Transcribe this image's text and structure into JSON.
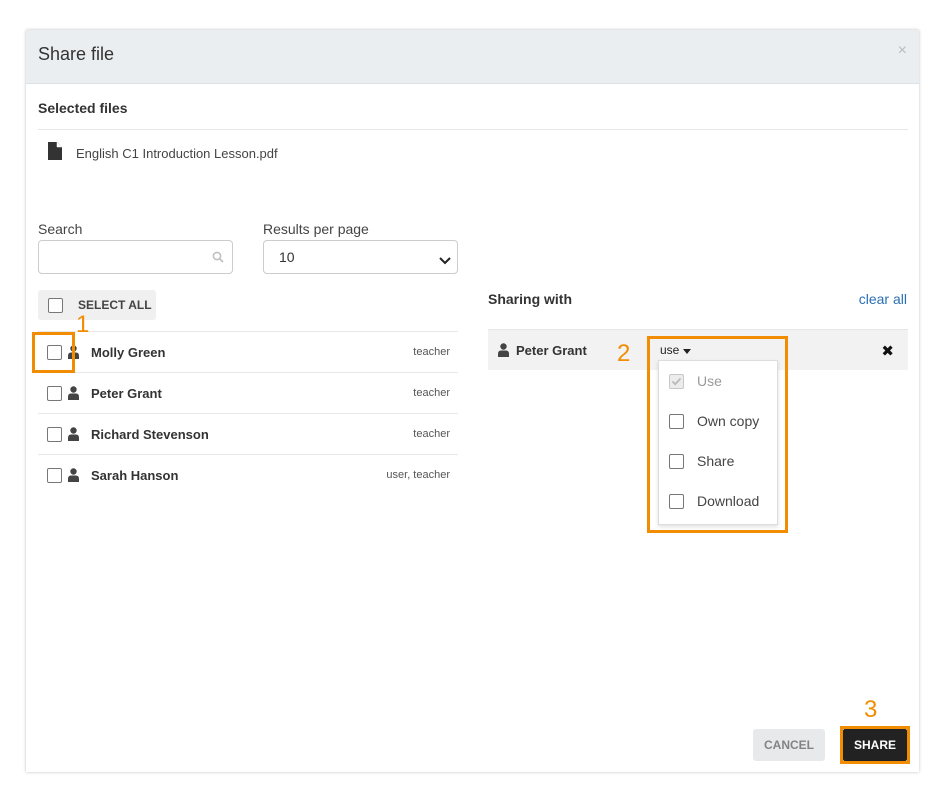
{
  "dialog": {
    "title": "Share file",
    "close_glyph": "×"
  },
  "selected_files": {
    "label": "Selected files",
    "files": [
      {
        "name": "English C1 Introduction Lesson.pdf",
        "icon": "file-icon"
      }
    ]
  },
  "search": {
    "label": "Search",
    "value": "",
    "placeholder": ""
  },
  "results_per_page": {
    "label": "Results per page",
    "selected": "10"
  },
  "select_all": {
    "label": "SELECT ALL",
    "checked": false
  },
  "users": [
    {
      "name": "Molly Green",
      "role": "teacher",
      "checked": false
    },
    {
      "name": "Peter Grant",
      "role": "teacher",
      "checked": false
    },
    {
      "name": "Richard Stevenson",
      "role": "teacher",
      "checked": false
    },
    {
      "name": "Sarah Hanson",
      "role": "user, teacher",
      "checked": false
    }
  ],
  "sharing": {
    "label": "Sharing with",
    "clear_all": "clear all",
    "entries": [
      {
        "name": "Peter Grant",
        "permission_label": "use",
        "remove_glyph": "✖"
      }
    ]
  },
  "permissions_menu": {
    "items": [
      {
        "label": "Use",
        "checked": true,
        "disabled": true
      },
      {
        "label": "Own copy",
        "checked": false,
        "disabled": false
      },
      {
        "label": "Share",
        "checked": false,
        "disabled": false
      },
      {
        "label": "Download",
        "checked": false,
        "disabled": false
      }
    ]
  },
  "footer": {
    "cancel_label": "CANCEL",
    "share_label": "SHARE"
  },
  "annotations": {
    "step1": "1",
    "step2": "2",
    "step3": "3",
    "color": "#f28c00"
  }
}
